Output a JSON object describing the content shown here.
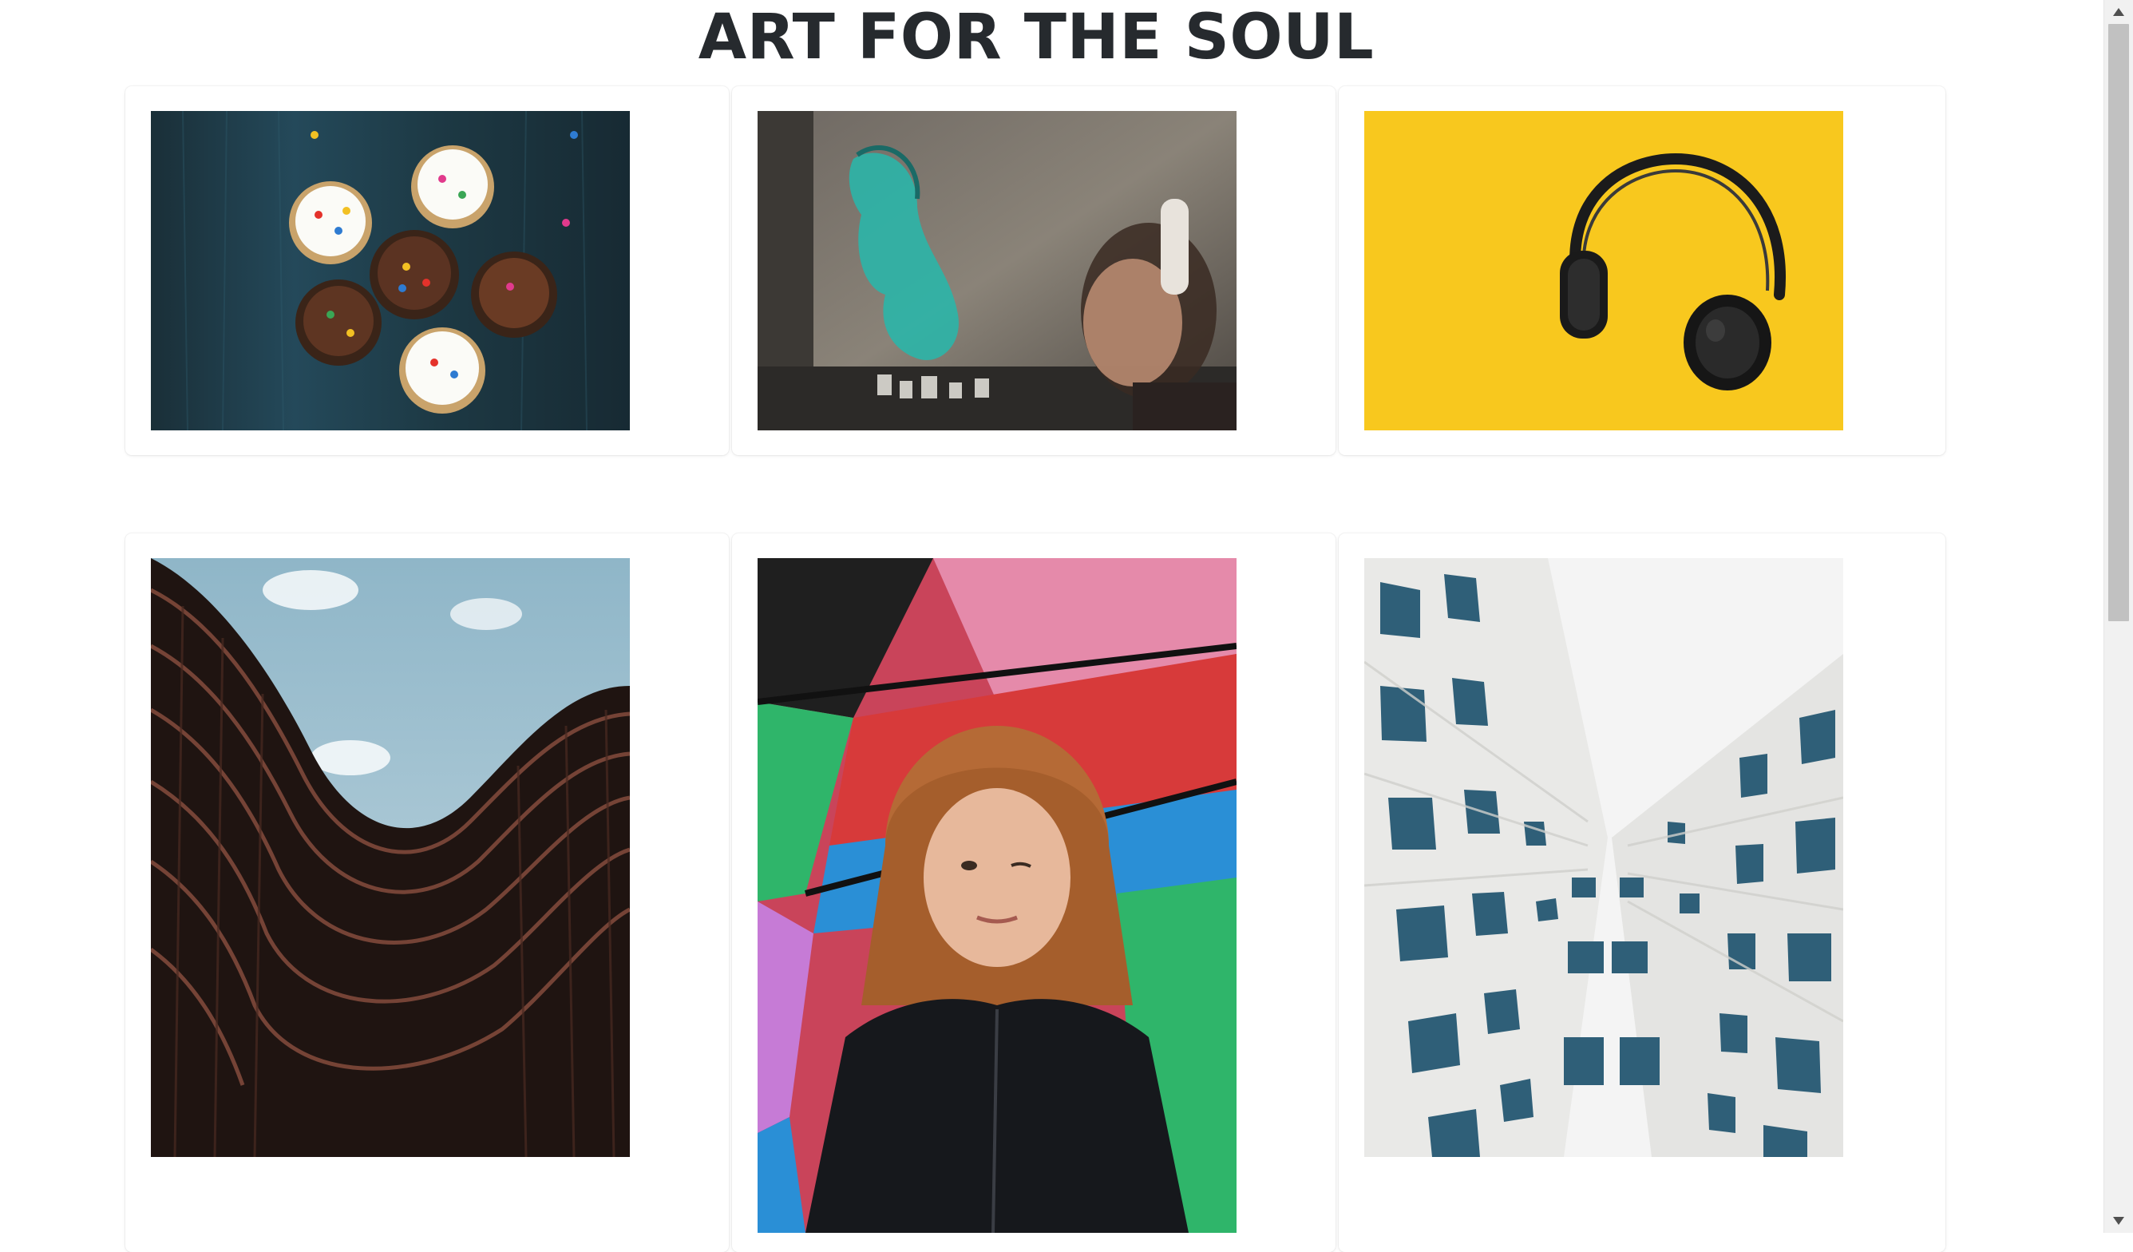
{
  "page": {
    "title": "ART FOR THE SOUL"
  },
  "gallery": {
    "row1": [
      {
        "icon": "cupcakes-photo"
      },
      {
        "icon": "street-art-photo"
      },
      {
        "icon": "headphones-photo"
      }
    ],
    "row2": [
      {
        "icon": "curved-building-photo"
      },
      {
        "icon": "graffiti-portrait-photo"
      },
      {
        "icon": "skyscraper-windows-photo"
      }
    ]
  },
  "colors": {
    "title": "#262a2e",
    "headphones_bg": "#f8c81e",
    "cupcake_board": "#1e3a45"
  }
}
